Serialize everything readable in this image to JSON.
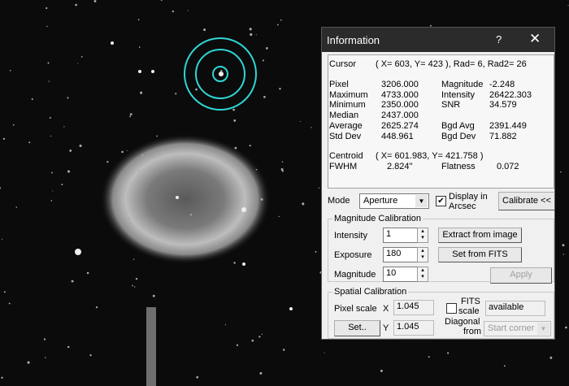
{
  "dialog": {
    "title": "Information",
    "help_label": "?",
    "close_label": "✕"
  },
  "info": {
    "cursor_label": "Cursor",
    "cursor_value": "( X=  603, Y=  423 ), Rad=  6, Rad2= 26",
    "rows_left": [
      {
        "label": "Pixel",
        "value": "3206.000"
      },
      {
        "label": "Maximum",
        "value": "4733.000"
      },
      {
        "label": "Minimum",
        "value": "2350.000"
      },
      {
        "label": "Median",
        "value": "2437.000"
      },
      {
        "label": "Average",
        "value": "2625.274"
      },
      {
        "label": "Std Dev",
        "value": "448.961"
      }
    ],
    "rows_right": [
      {
        "label": "Magnitude",
        "value": "-2.248"
      },
      {
        "label": "Intensity",
        "value": "26422.303"
      },
      {
        "label": "SNR",
        "value": "34.579"
      },
      {
        "label": "",
        "value": ""
      },
      {
        "label": "Bgd Avg",
        "value": "2391.449"
      },
      {
        "label": "Bgd Dev",
        "value": "71.882"
      }
    ],
    "centroid_label": "Centroid",
    "centroid_value": "( X=  601.983, Y=  421.758 )",
    "fwhm_label": "FWHM",
    "fwhm_value": "2.824\"",
    "flatness_label": "Flatness",
    "flatness_value": "0.072"
  },
  "mode": {
    "label": "Mode",
    "value": "Aperture",
    "arcsec_label1": "Display in",
    "arcsec_label2": "Arcsec",
    "arcsec_checked": true,
    "calibrate_label": "Calibrate <<"
  },
  "magcal": {
    "title": "Magnitude Calibration",
    "intensity_label": "Intensity",
    "intensity": "1",
    "exposure_label": "Exposure",
    "exposure": "180",
    "magnitude_label": "Magnitude",
    "magnitude": "10",
    "extract_label": "Extract from image",
    "fits_label": "Set from FITS",
    "apply_label": "Apply"
  },
  "spatial": {
    "title": "Spatial Calibration",
    "pixel_scale_label": "Pixel scale",
    "x_label": "X",
    "x": "1.045",
    "y_label": "Y",
    "y": "1.045",
    "set_label": "Set..",
    "fits_scale_label1": "FITS",
    "fits_scale_label2": "scale",
    "fits_available": "available",
    "diagonal_label1": "Diagonal",
    "diagonal_label2": "from",
    "diagonal_value": "Start corner"
  },
  "colors": {
    "aperture": "#2fd6d6",
    "titlebar": "#2b2b2b"
  }
}
